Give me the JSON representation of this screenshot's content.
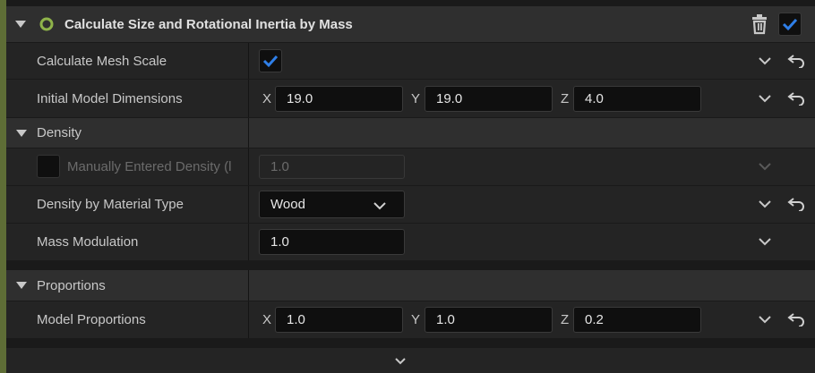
{
  "header": {
    "title": "Calculate Size and Rotational Inertia by Mass",
    "enabled": true
  },
  "rows": {
    "calc_mesh_scale": {
      "label": "Calculate Mesh Scale",
      "checked": true
    },
    "initial_dims": {
      "label": "Initial Model Dimensions",
      "x_label": "X",
      "x": "19.0",
      "y_label": "Y",
      "y": "19.0",
      "z_label": "Z",
      "z": "4.0"
    },
    "density_by_material": {
      "label": "Density by Material Type",
      "value": "Wood"
    },
    "mass_modulation": {
      "label": "Mass Modulation",
      "value": "1.0"
    },
    "manual_density": {
      "label": "Manually Entered Density (l",
      "value": "1.0",
      "checked": false
    },
    "model_props": {
      "label": "Model Proportions",
      "x_label": "X",
      "x": "1.0",
      "y_label": "Y",
      "y": "1.0",
      "z_label": "Z",
      "z": "0.2"
    }
  },
  "categories": {
    "density": "Density",
    "proportions": "Proportions"
  },
  "icons": {
    "collapse": "triangle-down-icon",
    "enable": "circle-ring-icon",
    "trash": "trash-icon",
    "checkbox": "checkmark-icon",
    "expand": "chevron-down-icon",
    "reset": "reset-arrow-icon"
  },
  "colors": {
    "accent": "#5e6d36",
    "check_blue": "#2f7fe8",
    "ring_green": "#8fb34a"
  }
}
